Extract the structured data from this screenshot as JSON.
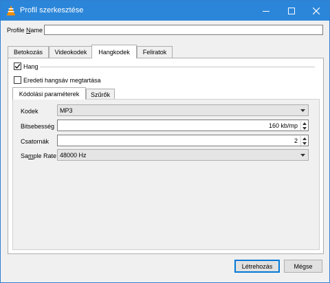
{
  "window": {
    "title": "Profil szerkesztése",
    "controls": {
      "minimize": "minimize-icon",
      "maximize": "maximize-icon",
      "close": "close-icon"
    }
  },
  "profile": {
    "label_pre": "Profile ",
    "label_u": "N",
    "label_post": "ame",
    "value": ""
  },
  "tabs": [
    {
      "label": "Betokozás",
      "active": false
    },
    {
      "label": "Videokodek",
      "active": false
    },
    {
      "label": "Hangkodek",
      "active": true
    },
    {
      "label": "Feliratok",
      "active": false
    }
  ],
  "audio": {
    "enable_label": "Hang",
    "enable_checked": true,
    "keep_label": "Eredeti hangsáv megtartása",
    "keep_checked": false
  },
  "subtabs": [
    {
      "label": "Kódolási paraméterek",
      "active": true
    },
    {
      "label": "Szűrők",
      "active": false
    }
  ],
  "params": {
    "codec_label": "Kodek",
    "codec_value": "MP3",
    "bitrate_label": "Bitsebesség",
    "bitrate_value": "160 kb/mp",
    "channels_label": "Csatornák",
    "channels_value": "2",
    "samplerate_label_pre": "Sa",
    "samplerate_label_u": "m",
    "samplerate_label_post": "ple Rate",
    "samplerate_value": "48000 Hz"
  },
  "buttons": {
    "create": "Létrehozás",
    "cancel": "Mégse"
  }
}
